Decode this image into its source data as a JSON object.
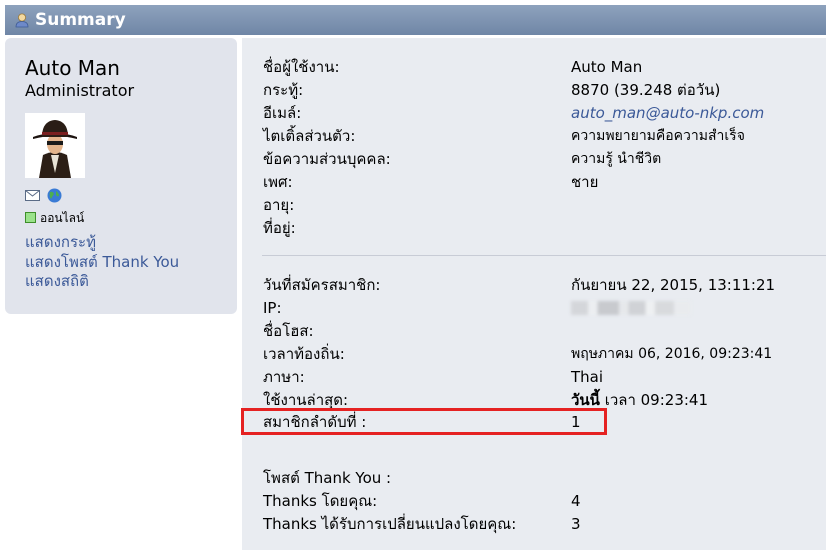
{
  "header": {
    "title": "Summary",
    "icon": "user-icon"
  },
  "profile": {
    "name": "Auto Man",
    "role": "Administrator",
    "status": "ออนไลน์",
    "links": [
      "แสดงกระทู้",
      "แสดงโพสต์ Thank You",
      "แสดงสถิติ"
    ]
  },
  "info_top": [
    {
      "label": "ชื่อผู้ใช้งาน:",
      "value": "Auto Man"
    },
    {
      "label": "กระทู้:",
      "value": "8870 (39.248 ต่อวัน)"
    },
    {
      "label": "อีเมล์:",
      "value": "auto_man@auto-nkp.com"
    },
    {
      "label": "ไตเติ้ลส่วนตัว:",
      "value": "ความพยายามคือความสำเร็จ"
    },
    {
      "label": "ข้อความส่วนบุคคล:",
      "value": "ความรู้ นำชีวิต"
    },
    {
      "label": "เพศ:",
      "value": "ชาย"
    },
    {
      "label": "อายุ:",
      "value": ""
    },
    {
      "label": "ที่อยู่:",
      "value": ""
    }
  ],
  "info_bottom": [
    {
      "label": "วันที่สมัครสมาชิก:",
      "value": "กันยายน 22, 2015, 13:11:21"
    },
    {
      "label": "IP:",
      "value": ""
    },
    {
      "label": "ชื่อโฮส:",
      "value": ""
    },
    {
      "label": "เวลาท้องถิ่น:",
      "value": "พฤษภาคม 06, 2016, 09:23:41"
    },
    {
      "label": "ภาษา:",
      "value": "Thai"
    },
    {
      "label": "ใช้งานล่าสุด:",
      "value_bold": "วันนี้",
      "value": " เวลา 09:23:41"
    },
    {
      "label": "สมาชิกลำดับที่ :",
      "value": "1"
    }
  ],
  "thanks": {
    "heading": "โพสต์ Thank You :",
    "rows": [
      {
        "label": "Thanks โดยคุณ:",
        "value": "4"
      },
      {
        "label": "Thanks ได้รับการเปลี่ยนแปลงโดยคุณ:",
        "value": "3"
      }
    ]
  },
  "colors": {
    "link": "#3b5998",
    "highlight": "#e52222",
    "header": "#7a8fae"
  }
}
